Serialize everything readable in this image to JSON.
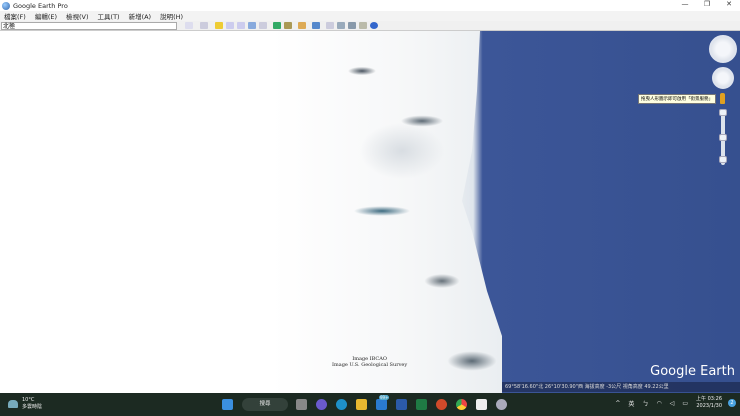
{
  "window": {
    "title": "Google Earth Pro",
    "controls": [
      "—",
      "❐",
      "✕"
    ]
  },
  "menu": [
    "檔案(F)",
    "編輯(E)",
    "檢視(V)",
    "工具(T)",
    "新增(A)",
    "說明(H)"
  ],
  "search": {
    "value": "北極"
  },
  "map": {
    "credits": [
      "Image IBCAO",
      "Image U.S. Geological Survey"
    ],
    "logo": "Google Earth",
    "status": "69°58'16.60\"北 26°10'30.90\"西 海拔高度 -3公尺 視角高度 49.22公里",
    "tooltip": "拖曳人形圖示即可啟用「街景服務」"
  },
  "taskbar": {
    "weather_temp": "10°C",
    "weather_desc": "多雲時陰",
    "search_label": "搜尋",
    "badge": "99+",
    "tray_lang": "英",
    "time": "上午 03:26",
    "date": "2023/1/30",
    "notif": "2"
  },
  "colors": {
    "ocean": "#36508f",
    "taskbar": "#1c2a22"
  }
}
